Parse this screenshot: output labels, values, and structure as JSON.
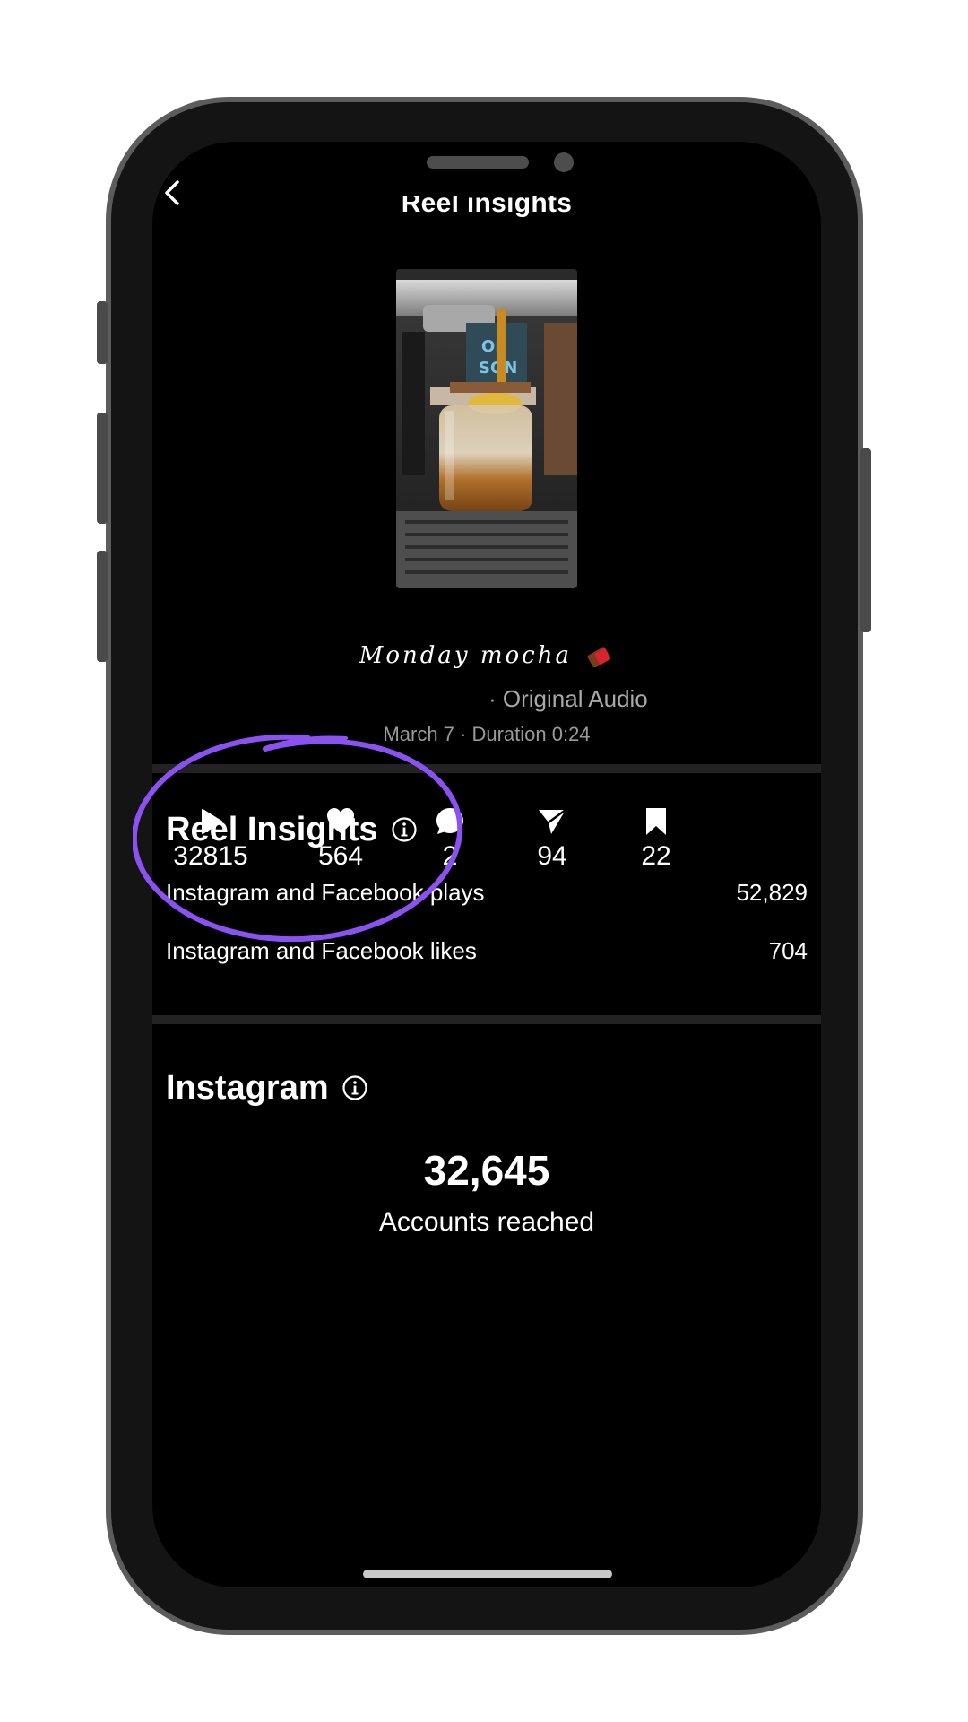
{
  "header": {
    "title": "Reel insights"
  },
  "reel": {
    "caption": "Monday mocha",
    "audio": "· Original Audio",
    "meta": "March 7 · Duration 0:24"
  },
  "stats": {
    "plays": "32815",
    "likes": "564",
    "comments": "2",
    "shares": "94",
    "saves": "22"
  },
  "reel_insights": {
    "title": "Reel Insights",
    "rows": [
      {
        "label": "Instagram and Facebook plays",
        "value": "52,829"
      },
      {
        "label": "Instagram and Facebook likes",
        "value": "704"
      }
    ]
  },
  "instagram": {
    "title": "Instagram",
    "accounts_reached_value": "32,645",
    "accounts_reached_label": "Accounts reached"
  },
  "colors": {
    "background": "#000000",
    "annotation_circle": "#8a52f0",
    "muted_text": "#a8a8a8",
    "divider": "#232323"
  },
  "icons": {
    "back": "chevron-left-icon",
    "plays": "play-icon",
    "likes": "heart-icon",
    "comments": "comment-bubble-icon",
    "shares": "paper-plane-icon",
    "saves": "bookmark-icon",
    "info": "info-icon"
  }
}
